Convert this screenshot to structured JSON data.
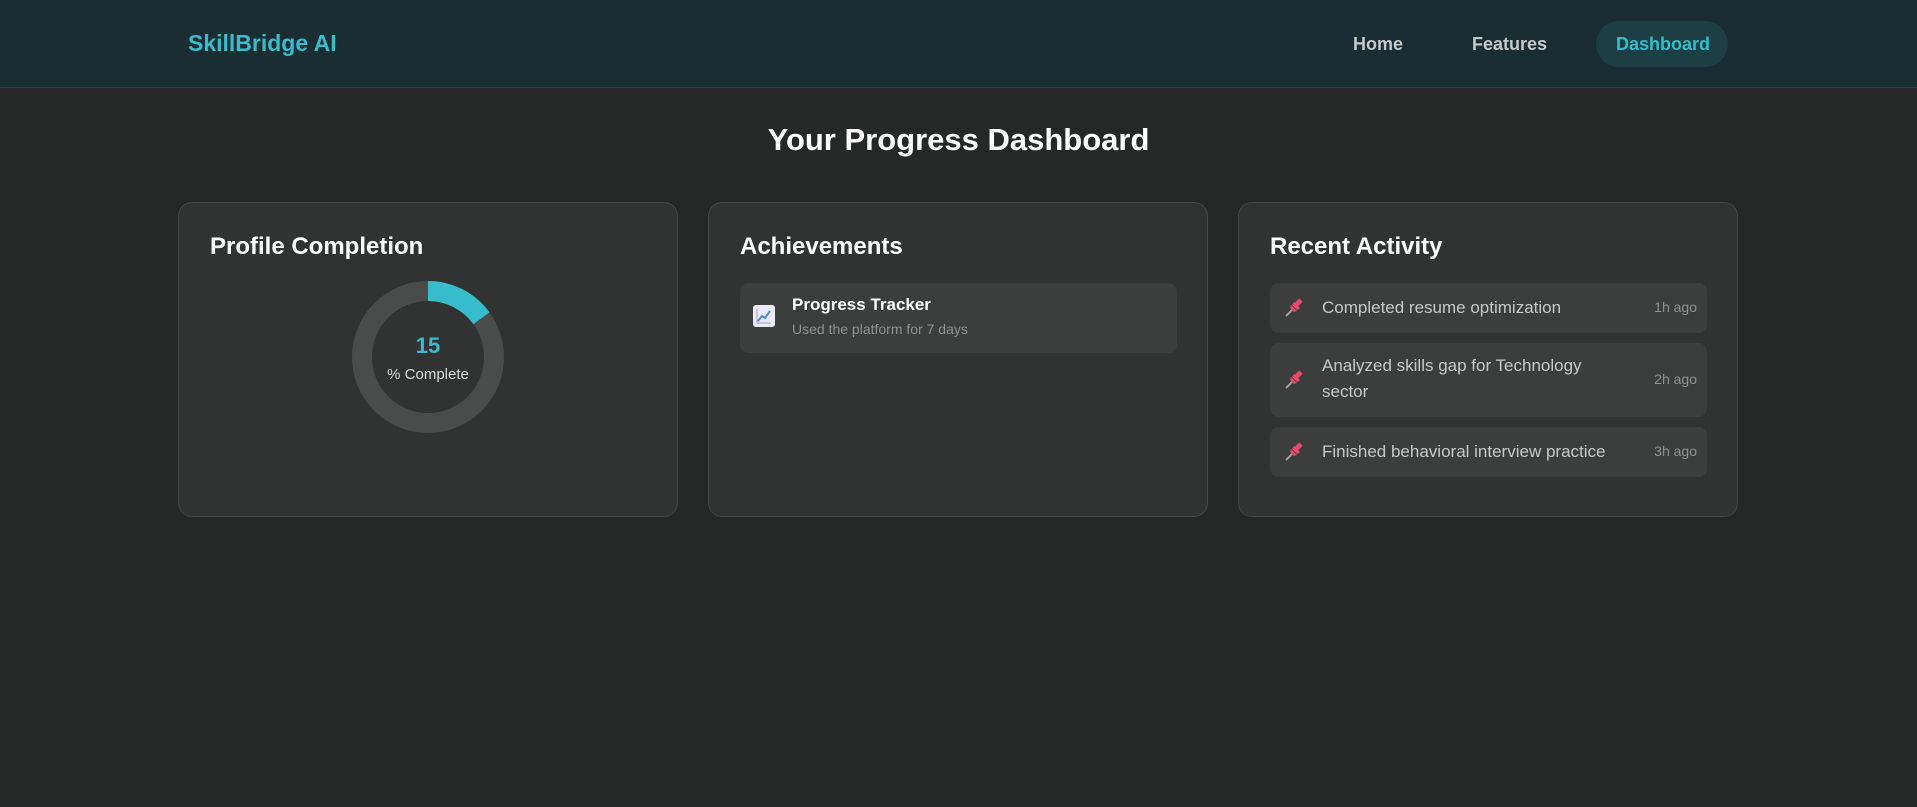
{
  "nav": {
    "brand": "SkillBridge AI",
    "links": [
      {
        "label": "Home",
        "active": false
      },
      {
        "label": "Features",
        "active": false
      },
      {
        "label": "Dashboard",
        "active": true
      }
    ]
  },
  "main": {
    "title": "Your Progress Dashboard"
  },
  "profile_card": {
    "title": "Profile Completion",
    "value": "15",
    "value_label": "% Complete",
    "progress_percent": 15
  },
  "achievements_card": {
    "title": "Achievements",
    "items": [
      {
        "icon": "chart-increasing-icon",
        "title": "Progress Tracker",
        "description": "Used the platform for 7 days"
      }
    ]
  },
  "activity_card": {
    "title": "Recent Activity",
    "items": [
      {
        "icon": "pushpin-icon",
        "text": "Completed resume optimization",
        "time": "1h ago"
      },
      {
        "icon": "pushpin-icon",
        "text": "Analyzed skills gap for Technology sector",
        "time": "2h ago"
      },
      {
        "icon": "pushpin-icon",
        "text": "Finished behavioral interview practice",
        "time": "3h ago"
      }
    ]
  },
  "colors": {
    "background": "#262827",
    "navbar": "#1a2d33",
    "accent": "#36bccb",
    "card": "#313332",
    "item": "#3c3e3d",
    "pin": "#e84a6f"
  }
}
